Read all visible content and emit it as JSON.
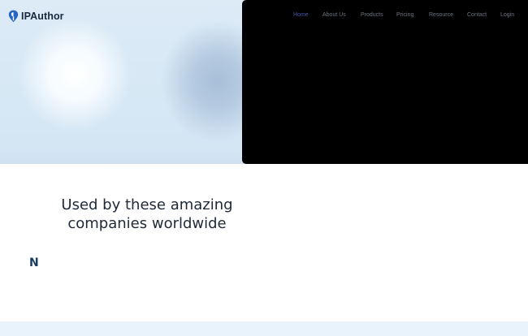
{
  "brand": {
    "name": "IPAuthor",
    "icon": "location-pin-logo-icon",
    "accent_color": "#2563c9"
  },
  "nav": {
    "items": [
      {
        "label": "Home",
        "active": true
      },
      {
        "label": "About Us",
        "active": false
      },
      {
        "label": "Products",
        "active": false
      },
      {
        "label": "Pricing",
        "active": false
      },
      {
        "label": "Resource",
        "active": false
      },
      {
        "label": "Contact",
        "active": false
      },
      {
        "label": "Login",
        "active": false
      }
    ],
    "active_color": "#4a57a8",
    "text_color": "#6f7480"
  },
  "hero": {
    "video_background": "#000000"
  },
  "logos_section": {
    "heading": "Used by these amazing companies worldwide",
    "logos": [
      {
        "text": "N",
        "color": "#173a66"
      }
    ]
  },
  "footer_band": {
    "color": "#e8f3fc"
  }
}
